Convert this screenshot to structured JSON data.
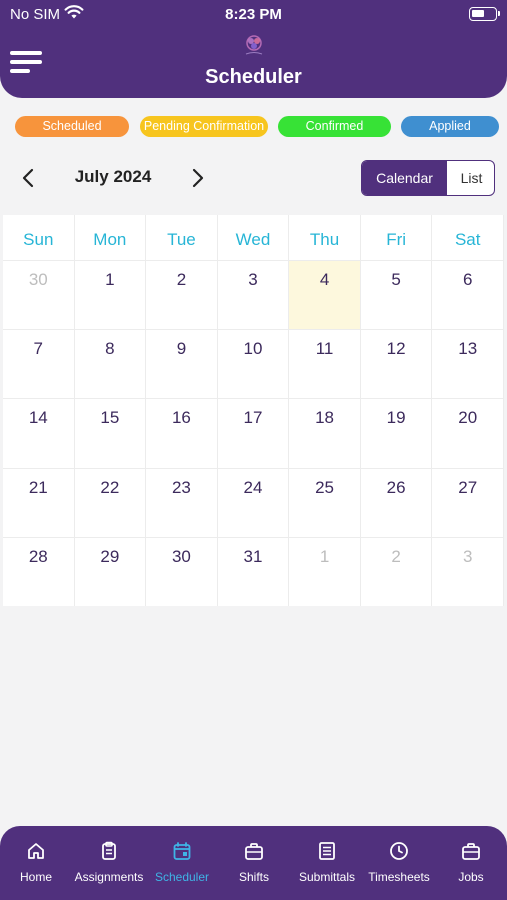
{
  "status_bar": {
    "carrier": "No SIM",
    "time": "8:23 PM"
  },
  "header": {
    "title": "Scheduler"
  },
  "legend": [
    {
      "label": "Scheduled",
      "color": "#f7943c"
    },
    {
      "label": "Pending Confirmation",
      "color": "#f7c51e"
    },
    {
      "label": "Confirmed",
      "color": "#37e236"
    },
    {
      "label": "Applied",
      "color": "#3f8fd0"
    }
  ],
  "calendar": {
    "month_label": "July 2024",
    "view_options": {
      "calendar": "Calendar",
      "list": "List",
      "selected": "Calendar"
    },
    "weekdays": [
      "Sun",
      "Mon",
      "Tue",
      "Wed",
      "Thu",
      "Fri",
      "Sat"
    ],
    "weeks": [
      [
        "30",
        "1",
        "2",
        "3",
        "4",
        "5",
        "6"
      ],
      [
        "7",
        "8",
        "9",
        "10",
        "11",
        "12",
        "13"
      ],
      [
        "14",
        "15",
        "16",
        "17",
        "18",
        "19",
        "20"
      ],
      [
        "21",
        "22",
        "23",
        "24",
        "25",
        "26",
        "27"
      ],
      [
        "28",
        "29",
        "30",
        "31",
        "1",
        "2",
        "3"
      ]
    ],
    "today": "4",
    "colors": {
      "weekday": "#27b5d6",
      "day": "#3c2a5c",
      "outside_month": "#bdbdbd",
      "today_bg": "#fdf8dd"
    }
  },
  "tabbar": {
    "items": [
      {
        "label": "Home",
        "icon": "home-icon"
      },
      {
        "label": "Assignments",
        "icon": "clipboard-icon"
      },
      {
        "label": "Scheduler",
        "icon": "calendar-icon"
      },
      {
        "label": "Shifts",
        "icon": "briefcase-icon"
      },
      {
        "label": "Submittals",
        "icon": "document-list-icon"
      },
      {
        "label": "Timesheets",
        "icon": "clock-icon"
      },
      {
        "label": "Jobs",
        "icon": "briefcase-icon"
      }
    ],
    "active": "Scheduler",
    "active_color": "#3fb4e6"
  },
  "theme": {
    "primary": "#50307d",
    "background": "#f3f3f4"
  }
}
